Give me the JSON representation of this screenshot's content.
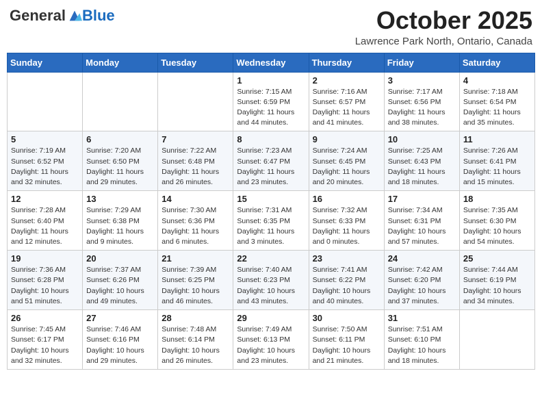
{
  "header": {
    "logo_general": "General",
    "logo_blue": "Blue",
    "month_title": "October 2025",
    "location": "Lawrence Park North, Ontario, Canada"
  },
  "days_of_week": [
    "Sunday",
    "Monday",
    "Tuesday",
    "Wednesday",
    "Thursday",
    "Friday",
    "Saturday"
  ],
  "weeks": [
    [
      {
        "day": "",
        "info": ""
      },
      {
        "day": "",
        "info": ""
      },
      {
        "day": "",
        "info": ""
      },
      {
        "day": "1",
        "info": "Sunrise: 7:15 AM\nSunset: 6:59 PM\nDaylight: 11 hours and 44 minutes."
      },
      {
        "day": "2",
        "info": "Sunrise: 7:16 AM\nSunset: 6:57 PM\nDaylight: 11 hours and 41 minutes."
      },
      {
        "day": "3",
        "info": "Sunrise: 7:17 AM\nSunset: 6:56 PM\nDaylight: 11 hours and 38 minutes."
      },
      {
        "day": "4",
        "info": "Sunrise: 7:18 AM\nSunset: 6:54 PM\nDaylight: 11 hours and 35 minutes."
      }
    ],
    [
      {
        "day": "5",
        "info": "Sunrise: 7:19 AM\nSunset: 6:52 PM\nDaylight: 11 hours and 32 minutes."
      },
      {
        "day": "6",
        "info": "Sunrise: 7:20 AM\nSunset: 6:50 PM\nDaylight: 11 hours and 29 minutes."
      },
      {
        "day": "7",
        "info": "Sunrise: 7:22 AM\nSunset: 6:48 PM\nDaylight: 11 hours and 26 minutes."
      },
      {
        "day": "8",
        "info": "Sunrise: 7:23 AM\nSunset: 6:47 PM\nDaylight: 11 hours and 23 minutes."
      },
      {
        "day": "9",
        "info": "Sunrise: 7:24 AM\nSunset: 6:45 PM\nDaylight: 11 hours and 20 minutes."
      },
      {
        "day": "10",
        "info": "Sunrise: 7:25 AM\nSunset: 6:43 PM\nDaylight: 11 hours and 18 minutes."
      },
      {
        "day": "11",
        "info": "Sunrise: 7:26 AM\nSunset: 6:41 PM\nDaylight: 11 hours and 15 minutes."
      }
    ],
    [
      {
        "day": "12",
        "info": "Sunrise: 7:28 AM\nSunset: 6:40 PM\nDaylight: 11 hours and 12 minutes."
      },
      {
        "day": "13",
        "info": "Sunrise: 7:29 AM\nSunset: 6:38 PM\nDaylight: 11 hours and 9 minutes."
      },
      {
        "day": "14",
        "info": "Sunrise: 7:30 AM\nSunset: 6:36 PM\nDaylight: 11 hours and 6 minutes."
      },
      {
        "day": "15",
        "info": "Sunrise: 7:31 AM\nSunset: 6:35 PM\nDaylight: 11 hours and 3 minutes."
      },
      {
        "day": "16",
        "info": "Sunrise: 7:32 AM\nSunset: 6:33 PM\nDaylight: 11 hours and 0 minutes."
      },
      {
        "day": "17",
        "info": "Sunrise: 7:34 AM\nSunset: 6:31 PM\nDaylight: 10 hours and 57 minutes."
      },
      {
        "day": "18",
        "info": "Sunrise: 7:35 AM\nSunset: 6:30 PM\nDaylight: 10 hours and 54 minutes."
      }
    ],
    [
      {
        "day": "19",
        "info": "Sunrise: 7:36 AM\nSunset: 6:28 PM\nDaylight: 10 hours and 51 minutes."
      },
      {
        "day": "20",
        "info": "Sunrise: 7:37 AM\nSunset: 6:26 PM\nDaylight: 10 hours and 49 minutes."
      },
      {
        "day": "21",
        "info": "Sunrise: 7:39 AM\nSunset: 6:25 PM\nDaylight: 10 hours and 46 minutes."
      },
      {
        "day": "22",
        "info": "Sunrise: 7:40 AM\nSunset: 6:23 PM\nDaylight: 10 hours and 43 minutes."
      },
      {
        "day": "23",
        "info": "Sunrise: 7:41 AM\nSunset: 6:22 PM\nDaylight: 10 hours and 40 minutes."
      },
      {
        "day": "24",
        "info": "Sunrise: 7:42 AM\nSunset: 6:20 PM\nDaylight: 10 hours and 37 minutes."
      },
      {
        "day": "25",
        "info": "Sunrise: 7:44 AM\nSunset: 6:19 PM\nDaylight: 10 hours and 34 minutes."
      }
    ],
    [
      {
        "day": "26",
        "info": "Sunrise: 7:45 AM\nSunset: 6:17 PM\nDaylight: 10 hours and 32 minutes."
      },
      {
        "day": "27",
        "info": "Sunrise: 7:46 AM\nSunset: 6:16 PM\nDaylight: 10 hours and 29 minutes."
      },
      {
        "day": "28",
        "info": "Sunrise: 7:48 AM\nSunset: 6:14 PM\nDaylight: 10 hours and 26 minutes."
      },
      {
        "day": "29",
        "info": "Sunrise: 7:49 AM\nSunset: 6:13 PM\nDaylight: 10 hours and 23 minutes."
      },
      {
        "day": "30",
        "info": "Sunrise: 7:50 AM\nSunset: 6:11 PM\nDaylight: 10 hours and 21 minutes."
      },
      {
        "day": "31",
        "info": "Sunrise: 7:51 AM\nSunset: 6:10 PM\nDaylight: 10 hours and 18 minutes."
      },
      {
        "day": "",
        "info": ""
      }
    ]
  ]
}
